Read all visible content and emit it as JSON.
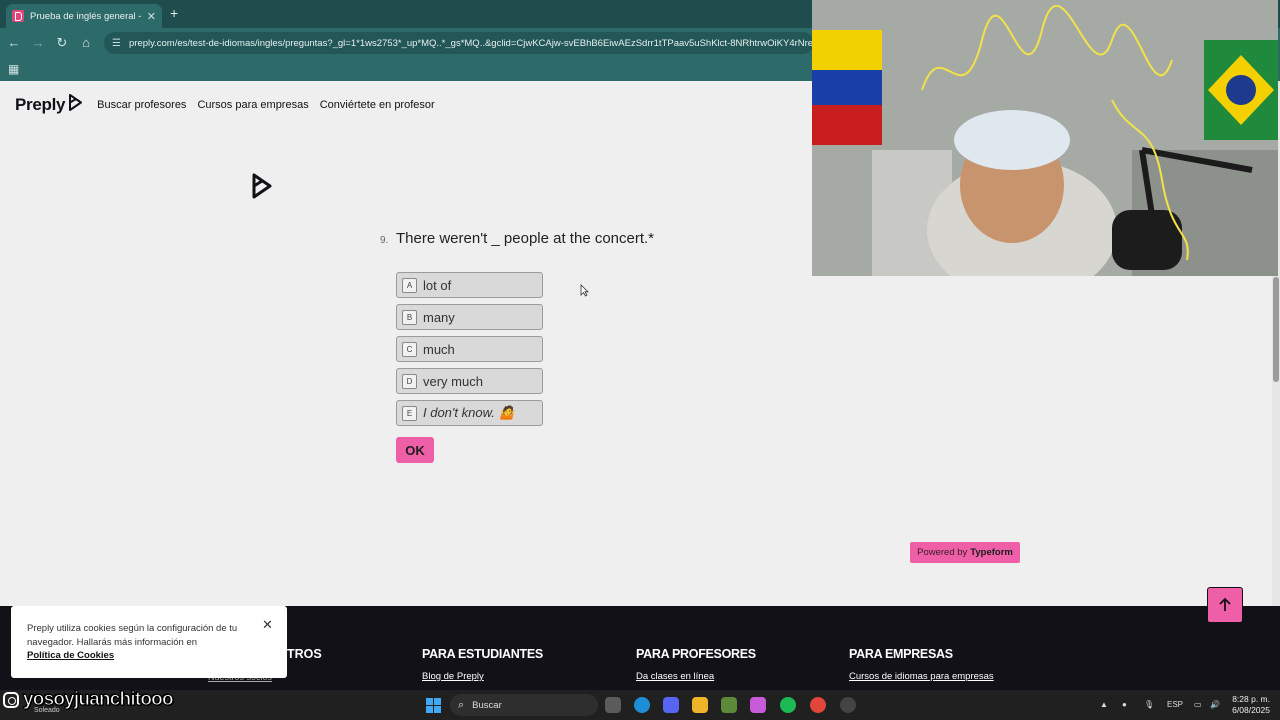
{
  "browser": {
    "tab_title": "Prueba de inglés general - Preply",
    "url": "preply.com/es/test-de-idiomas/ingles/preguntas?_gl=1*1ws2753*_up*MQ..*_gs*MQ..&gclid=CjwKCAjw-svEBhB6EiwAEzSdrr1tTPaav5uShKlct-8NRhtrwOiKY4rNresZuf0"
  },
  "header": {
    "logo": "Preply",
    "nav": [
      "Buscar profesores",
      "Cursos para empresas",
      "Conviértete en profesor"
    ]
  },
  "question": {
    "number": "9.",
    "text": "There weren't _ people at the concert.*",
    "options": [
      {
        "key": "A",
        "label": "lot of"
      },
      {
        "key": "B",
        "label": "many"
      },
      {
        "key": "C",
        "label": "much"
      },
      {
        "key": "D",
        "label": "very much"
      },
      {
        "key": "E",
        "label": "I don't know. 🤷"
      }
    ],
    "submit_label": "OK"
  },
  "powered": {
    "prefix": "Powered by",
    "brand": "Typeform"
  },
  "cookie": {
    "text": "Preply utiliza cookies según la configuración de tu navegador. Hallarás más información en",
    "link": "Política de Cookies"
  },
  "footer": {
    "partial_head": "TROS",
    "partial_link": "Nuestros socios",
    "columns": [
      {
        "head": "PARA ESTUDIANTES",
        "link": "Blog de Preply"
      },
      {
        "head": "PARA PROFESORES",
        "link": "Da clases en línea"
      },
      {
        "head": "PARA EMPRESAS",
        "link": "Cursos de idiomas para empresas"
      }
    ]
  },
  "overlay": {
    "handle": "yosoyjuanchitooo",
    "weather": "Soleado"
  },
  "taskbar": {
    "search_placeholder": "Buscar",
    "lang": "ESP",
    "time": "8:28 p. m.",
    "date": "6/08/2025"
  },
  "colors": {
    "accent": "#ef5fa7",
    "chrome": "#2d6b6b",
    "footer": "#121117"
  }
}
